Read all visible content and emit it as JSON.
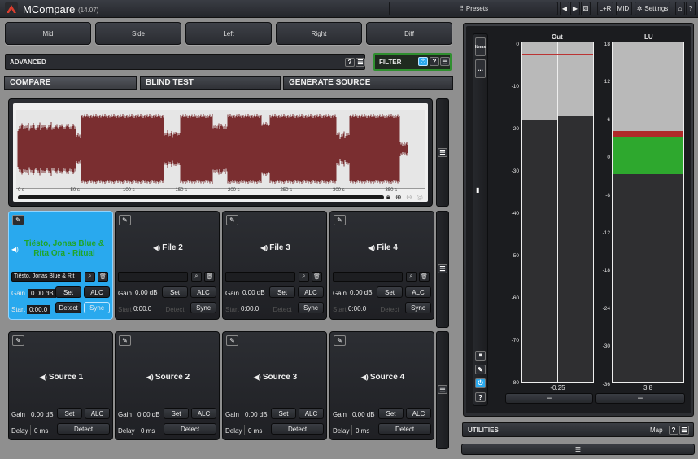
{
  "app": {
    "title": "MCompare",
    "version": "(14.07)"
  },
  "titlebar": {
    "presets": "Presets",
    "lr": "L+R",
    "midi": "MIDI",
    "settings": "Settings"
  },
  "channels": [
    "Mid",
    "Side",
    "Left",
    "Right",
    "Diff"
  ],
  "advanced": {
    "label": "ADVANCED",
    "help": "?",
    "menu": "☰"
  },
  "filter": {
    "label": "FILTER",
    "help": "?",
    "menu": "☰"
  },
  "tabs": [
    "COMPARE",
    "BLIND TEST",
    "GENERATE SOURCE"
  ],
  "waveform": {
    "ticks": [
      "0 s",
      "50 s",
      "100 s",
      "150 s",
      "200 s",
      "250 s",
      "300 s",
      "350 s"
    ]
  },
  "files": [
    {
      "name": "Tiësto, Jonas Blue & Rita Ora - Ritual",
      "field": "Tiësto, Jonas Blue & Rit",
      "gain_label": "Gain",
      "gain": "0.00 dB",
      "set": "Set",
      "alc": "ALC",
      "start_label": "Start",
      "start": "0:00.0",
      "detect": "Detect",
      "sync": "Sync",
      "active": true
    },
    {
      "name": "File 2",
      "field": "",
      "gain_label": "Gain",
      "gain": "0.00 dB",
      "set": "Set",
      "alc": "ALC",
      "start_label": "Start",
      "start": "0:00.0",
      "detect": "Detect",
      "sync": "Sync",
      "active": false
    },
    {
      "name": "File 3",
      "field": "",
      "gain_label": "Gain",
      "gain": "0.00 dB",
      "set": "Set",
      "alc": "ALC",
      "start_label": "Start",
      "start": "0:00.0",
      "detect": "Detect",
      "sync": "Sync",
      "active": false
    },
    {
      "name": "File 4",
      "field": "",
      "gain_label": "Gain",
      "gain": "0.00 dB",
      "set": "Set",
      "alc": "ALC",
      "start_label": "Start",
      "start": "0:00.0",
      "detect": "Detect",
      "sync": "Sync",
      "active": false
    }
  ],
  "sources": [
    {
      "name": "Source 1",
      "gain_label": "Gain",
      "gain": "0.00 dB",
      "set": "Set",
      "alc": "ALC",
      "delay_label": "Delay",
      "delay": "0 ms",
      "detect": "Detect"
    },
    {
      "name": "Source 2",
      "gain_label": "Gain",
      "gain": "0.00 dB",
      "set": "Set",
      "alc": "ALC",
      "delay_label": "Delay",
      "delay": "0 ms",
      "detect": "Detect"
    },
    {
      "name": "Source 3",
      "gain_label": "Gain",
      "gain": "0.00 dB",
      "set": "Set",
      "alc": "ALC",
      "delay_label": "Delay",
      "delay": "0 ms",
      "detect": "Detect"
    },
    {
      "name": "Source 4",
      "gain_label": "Gain",
      "gain": "0.00 dB",
      "set": "Set",
      "alc": "ALC",
      "delay_label": "Delay",
      "delay": "0 ms",
      "detect": "Detect"
    }
  ],
  "meters": {
    "out": {
      "title": "Out",
      "scale": [
        "0",
        "-10",
        "-20",
        "-30",
        "-40",
        "-50",
        "-60",
        "-70",
        "-80"
      ],
      "value": "-0.25",
      "left_level": "-18.5",
      "right_level": "-17.5",
      "peak": "-2.6"
    },
    "lu": {
      "title": "LU",
      "scale": [
        "18",
        "12",
        "6",
        "0",
        "-6",
        "-12",
        "-18",
        "-24",
        "-30",
        "-36"
      ],
      "value": "3.8",
      "level": "4.5"
    },
    "side_buttons": [
      "Items",
      "...",
      "⏸",
      "✎",
      "⏻",
      "?"
    ]
  },
  "utilities": {
    "label": "UTILITIES",
    "map": "Map",
    "help": "?",
    "menu": "☰"
  },
  "colors": {
    "accent": "#29a9ee",
    "waveform": "#7a2e30",
    "lu_green": "#2ea82e",
    "lu_red": "#b02a2a",
    "filter_green": "#2f8f2f"
  }
}
